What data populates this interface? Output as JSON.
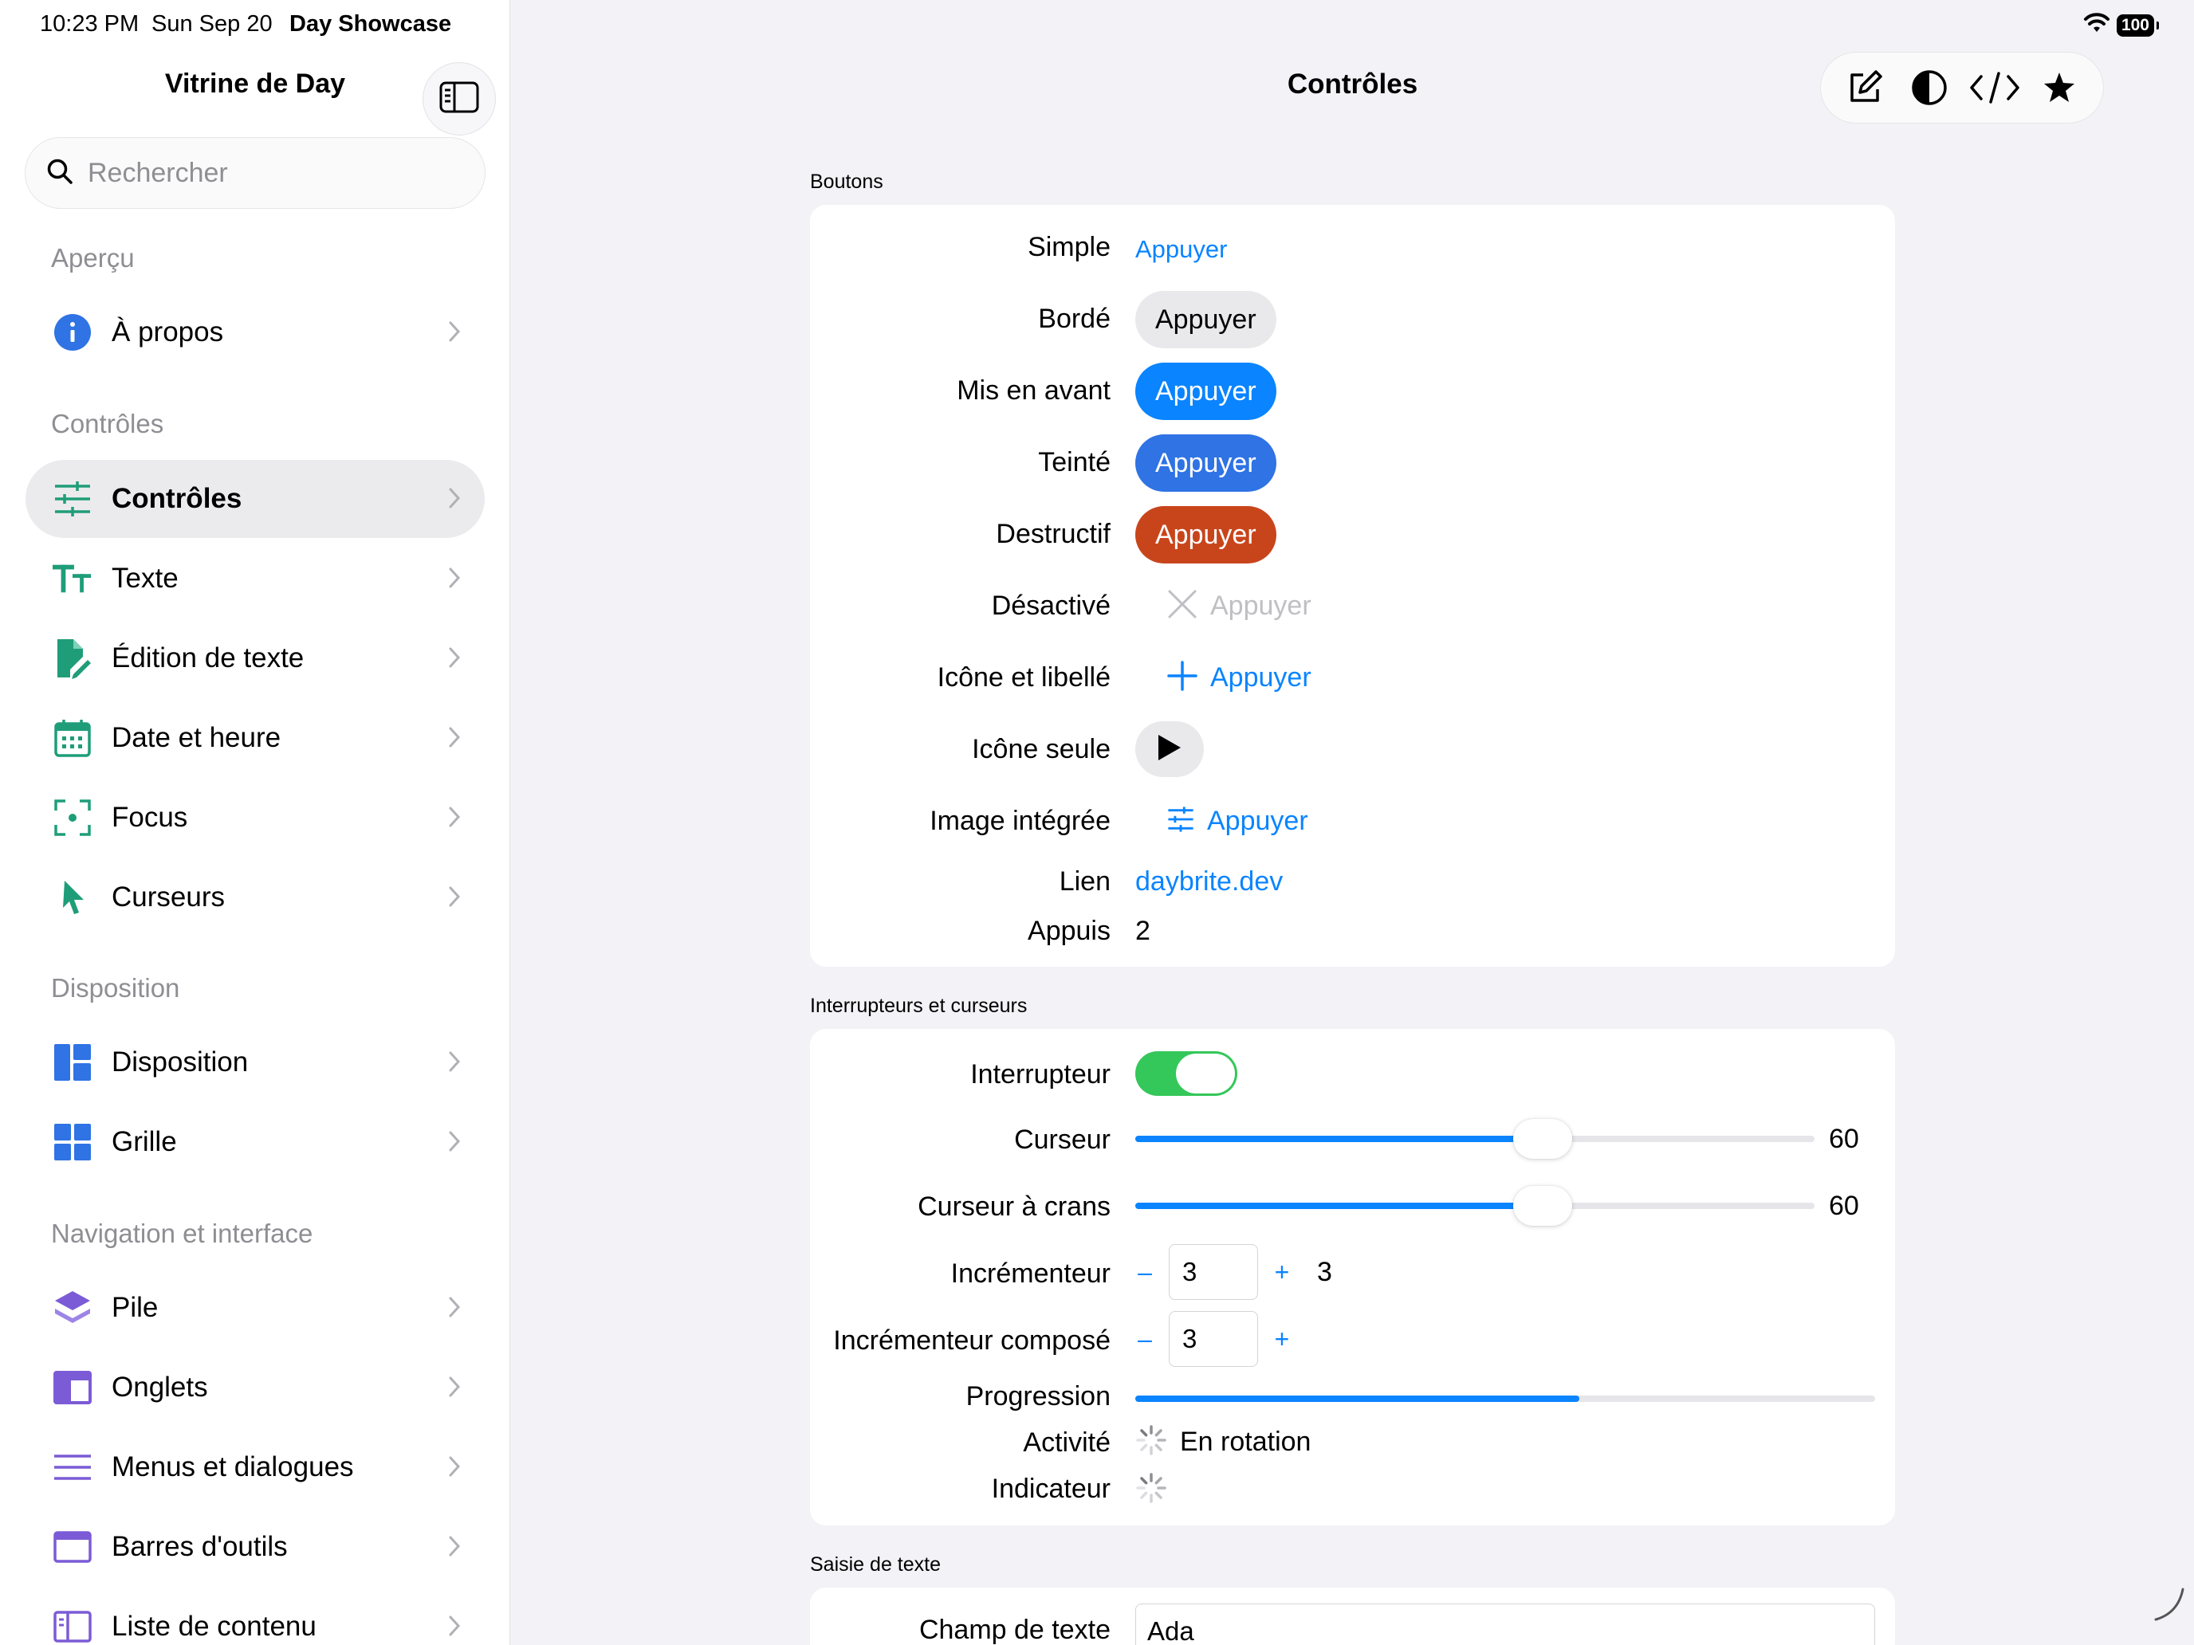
{
  "status": {
    "time": "10:23 PM",
    "date": "Sun Sep 20",
    "app": "Day Showcase",
    "battery": "100"
  },
  "sidebar": {
    "title": "Vitrine de Day",
    "search_placeholder": "Rechercher",
    "sections": [
      {
        "header": "Aperçu",
        "items": [
          {
            "label": "À propos",
            "icon": "info-icon"
          }
        ]
      },
      {
        "header": "Contrôles",
        "items": [
          {
            "label": "Contrôles",
            "icon": "sliders-icon",
            "selected": true
          },
          {
            "label": "Texte",
            "icon": "text-size-icon"
          },
          {
            "label": "Édition de texte",
            "icon": "edit-document-icon"
          },
          {
            "label": "Date et heure",
            "icon": "calendar-icon"
          },
          {
            "label": "Focus",
            "icon": "focus-icon"
          },
          {
            "label": "Curseurs",
            "icon": "pointer-icon"
          }
        ]
      },
      {
        "header": "Disposition",
        "items": [
          {
            "label": "Disposition",
            "icon": "layout-icon"
          },
          {
            "label": "Grille",
            "icon": "grid-icon"
          }
        ]
      },
      {
        "header": "Navigation et interface",
        "items": [
          {
            "label": "Pile",
            "icon": "stack-icon"
          },
          {
            "label": "Onglets",
            "icon": "tabs-icon"
          },
          {
            "label": "Menus et dialogues",
            "icon": "menu-lines-icon"
          },
          {
            "label": "Barres d'outils",
            "icon": "toolbar-icon"
          },
          {
            "label": "Liste de contenu",
            "icon": "sidebar-list-icon"
          }
        ]
      }
    ]
  },
  "main": {
    "title": "Contrôles",
    "toolbar": [
      "compose-icon",
      "contrast-icon",
      "code-icon",
      "star-icon"
    ],
    "buttons_group": {
      "header": "Boutons",
      "rows": {
        "simple": {
          "label": "Simple",
          "button": "Appuyer"
        },
        "bordered": {
          "label": "Bordé",
          "button": "Appuyer"
        },
        "prominent": {
          "label": "Mis en avant",
          "button": "Appuyer"
        },
        "tinted": {
          "label": "Teinté",
          "button": "Appuyer"
        },
        "destructive": {
          "label": "Destructif",
          "button": "Appuyer"
        },
        "disabled": {
          "label": "Désactivé",
          "button": "Appuyer"
        },
        "icon_label": {
          "label": "Icône et libellé",
          "button": "Appuyer"
        },
        "icon_only": {
          "label": "Icône seule"
        },
        "inline_image": {
          "label": "Image intégrée",
          "button": "Appuyer"
        },
        "link": {
          "label": "Lien",
          "value": "daybrite.dev"
        },
        "taps": {
          "label": "Appuis",
          "value": "2"
        }
      }
    },
    "switches_group": {
      "header": "Interrupteurs et curseurs",
      "toggle": {
        "label": "Interrupteur",
        "on": true
      },
      "slider": {
        "label": "Curseur",
        "value": 60,
        "value_text": "60",
        "fraction": 0.6
      },
      "stepped_slider": {
        "label": "Curseur à crans",
        "value": 60,
        "value_text": "60",
        "fraction": 0.6
      },
      "stepper": {
        "label": "Incrémenteur",
        "minus": "–",
        "plus": "+",
        "field": "3",
        "value": "3"
      },
      "compound_stepper": {
        "label": "Incrémenteur composé",
        "minus": "–",
        "plus": "+",
        "field": "3"
      },
      "progress": {
        "label": "Progression",
        "fraction": 0.6
      },
      "activity": {
        "label": "Activité",
        "text": "En rotation"
      },
      "indicator": {
        "label": "Indicateur"
      }
    },
    "text_group": {
      "header": "Saisie de texte",
      "text_field": {
        "label": "Champ de texte",
        "value": "Ada"
      }
    }
  },
  "colors": {
    "accent": "#0a84ff",
    "destructive": "#c8451c",
    "tinted": "#2f73e4",
    "toggle_on": "#34c759",
    "sidebar_icon": "#1f9d79"
  }
}
